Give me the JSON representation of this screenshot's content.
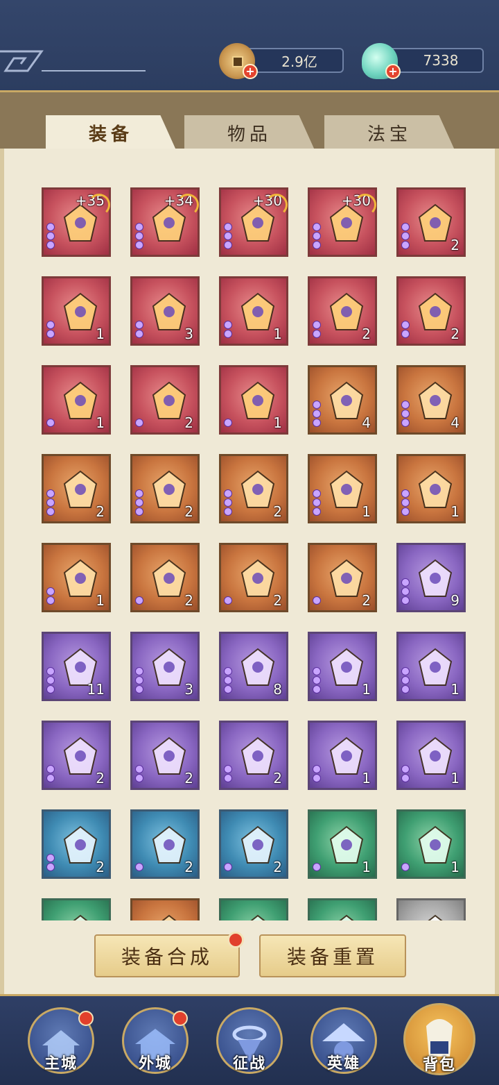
{
  "currency": {
    "coins": "2.9亿",
    "gems": "7338",
    "add_symbol": "+"
  },
  "tabs": [
    {
      "label": "装备",
      "active": true
    },
    {
      "label": "物品",
      "active": false
    },
    {
      "label": "法宝",
      "active": false
    }
  ],
  "inventory": {
    "rows": [
      [
        {
          "rarity": "red",
          "icon": "dragon-blade-icon",
          "level": "+35",
          "count": "",
          "beads": 3
        },
        {
          "rarity": "red",
          "icon": "jeweled-ring-icon",
          "level": "+34",
          "count": "",
          "beads": 3
        },
        {
          "rarity": "red",
          "icon": "gold-armor-icon",
          "level": "+30",
          "count": "",
          "beads": 3
        },
        {
          "rarity": "red",
          "icon": "winged-boots-icon",
          "level": "+30",
          "count": "",
          "beads": 3
        },
        {
          "rarity": "red",
          "icon": "red-spear-icon",
          "level": "",
          "count": "2",
          "beads": 3
        }
      ],
      [
        {
          "rarity": "red",
          "icon": "dragon-ring-icon",
          "level": "",
          "count": "1",
          "beads": 2
        },
        {
          "rarity": "red",
          "icon": "azure-orb-icon",
          "level": "",
          "count": "3",
          "beads": 2
        },
        {
          "rarity": "red",
          "icon": "jade-robe-icon",
          "level": "",
          "count": "1",
          "beads": 2
        },
        {
          "rarity": "red",
          "icon": "jade-pendant-icon",
          "level": "",
          "count": "2",
          "beads": 2
        },
        {
          "rarity": "red",
          "icon": "jade-boots-icon",
          "level": "",
          "count": "2",
          "beads": 2
        }
      ],
      [
        {
          "rarity": "red",
          "icon": "battle-axe-icon",
          "level": "",
          "count": "1",
          "beads": 1
        },
        {
          "rarity": "red",
          "icon": "blue-armor-icon",
          "level": "",
          "count": "2",
          "beads": 1
        },
        {
          "rarity": "red",
          "icon": "prayer-beads-icon",
          "level": "",
          "count": "1",
          "beads": 1
        },
        {
          "rarity": "orange",
          "icon": "dark-armor-icon",
          "level": "",
          "count": "4",
          "beads": 3
        },
        {
          "rarity": "orange",
          "icon": "dark-boots-icon",
          "level": "",
          "count": "4",
          "beads": 3
        }
      ],
      [
        {
          "rarity": "orange",
          "icon": "magic-staff-icon",
          "level": "",
          "count": "2",
          "beads": 3
        },
        {
          "rarity": "orange",
          "icon": "black-robe-icon",
          "level": "",
          "count": "2",
          "beads": 3
        },
        {
          "rarity": "orange",
          "icon": "black-ring-icon",
          "level": "",
          "count": "2",
          "beads": 3
        },
        {
          "rarity": "orange",
          "icon": "starry-boots-icon",
          "level": "",
          "count": "1",
          "beads": 3
        },
        {
          "rarity": "orange",
          "icon": "jade-spear-icon",
          "level": "",
          "count": "1",
          "beads": 3
        }
      ],
      [
        {
          "rarity": "orange",
          "icon": "jade-armor-icon",
          "level": "",
          "count": "1",
          "beads": 2
        },
        {
          "rarity": "orange",
          "icon": "jade-disc-icon",
          "level": "",
          "count": "2",
          "beads": 1
        },
        {
          "rarity": "orange",
          "icon": "cloud-boots-icon",
          "level": "",
          "count": "2",
          "beads": 1
        },
        {
          "rarity": "orange",
          "icon": "teal-boots-icon",
          "level": "",
          "count": "2",
          "beads": 1
        },
        {
          "rarity": "purple",
          "icon": "bow-icon",
          "level": "",
          "count": "9",
          "beads": 3
        }
      ],
      [
        {
          "rarity": "purple",
          "icon": "purple-armor-icon",
          "level": "",
          "count": "11",
          "beads": 3
        },
        {
          "rarity": "purple",
          "icon": "purple-ring-icon",
          "level": "",
          "count": "3",
          "beads": 3
        },
        {
          "rarity": "purple",
          "icon": "purple-boots-icon",
          "level": "",
          "count": "8",
          "beads": 3
        },
        {
          "rarity": "purple",
          "icon": "gold-ring-icon",
          "level": "",
          "count": "1",
          "beads": 3
        },
        {
          "rarity": "purple",
          "icon": "silver-boots-icon",
          "level": "",
          "count": "1",
          "beads": 3
        }
      ],
      [
        {
          "rarity": "purple",
          "icon": "azure-ring-icon",
          "level": "",
          "count": "2",
          "beads": 2
        },
        {
          "rarity": "purple",
          "icon": "azure-boots-icon",
          "level": "",
          "count": "2",
          "beads": 2
        },
        {
          "rarity": "purple",
          "icon": "azure-blade-icon",
          "level": "",
          "count": "2",
          "beads": 2
        },
        {
          "rarity": "purple",
          "icon": "azure-robe-icon",
          "level": "",
          "count": "1",
          "beads": 2
        },
        {
          "rarity": "purple",
          "icon": "white-boots-icon",
          "level": "",
          "count": "1",
          "beads": 2
        }
      ],
      [
        {
          "rarity": "blue",
          "icon": "red-armor-icon",
          "level": "",
          "count": "2",
          "beads": 2
        },
        {
          "rarity": "blue",
          "icon": "cleaver-icon",
          "level": "",
          "count": "2",
          "beads": 1
        },
        {
          "rarity": "blue",
          "icon": "red-pendant-icon",
          "level": "",
          "count": "2",
          "beads": 1
        },
        {
          "rarity": "green",
          "icon": "stone-talisman-icon",
          "level": "",
          "count": "1",
          "beads": 1
        },
        {
          "rarity": "green",
          "icon": "red-boots-icon",
          "level": "",
          "count": "1",
          "beads": 1
        }
      ],
      [
        {
          "rarity": "green",
          "icon": "dagger-icon",
          "level": "",
          "count": "",
          "beads": 0
        },
        {
          "rarity": "orange",
          "icon": "helmet-icon",
          "level": "",
          "count": "",
          "beads": 0
        },
        {
          "rarity": "green",
          "icon": "amulet-icon",
          "level": "",
          "count": "",
          "beads": 0
        },
        {
          "rarity": "green",
          "icon": "shoe-icon",
          "level": "",
          "count": "",
          "beads": 0
        },
        {
          "rarity": "gray",
          "icon": "hammer-icon",
          "level": "",
          "count": "",
          "beads": 0
        }
      ]
    ]
  },
  "actions": {
    "synthesize": "装备合成",
    "reset": "装备重置"
  },
  "nav": [
    {
      "label": "主城",
      "icon": "main-city-icon",
      "badge": true,
      "active": false
    },
    {
      "label": "外城",
      "icon": "outer-city-icon",
      "badge": true,
      "active": false
    },
    {
      "label": "征战",
      "icon": "campaign-icon",
      "badge": false,
      "active": false
    },
    {
      "label": "英雄",
      "icon": "hero-icon",
      "badge": false,
      "active": false
    },
    {
      "label": "背包",
      "icon": "backpack-icon",
      "badge": false,
      "active": true
    }
  ]
}
